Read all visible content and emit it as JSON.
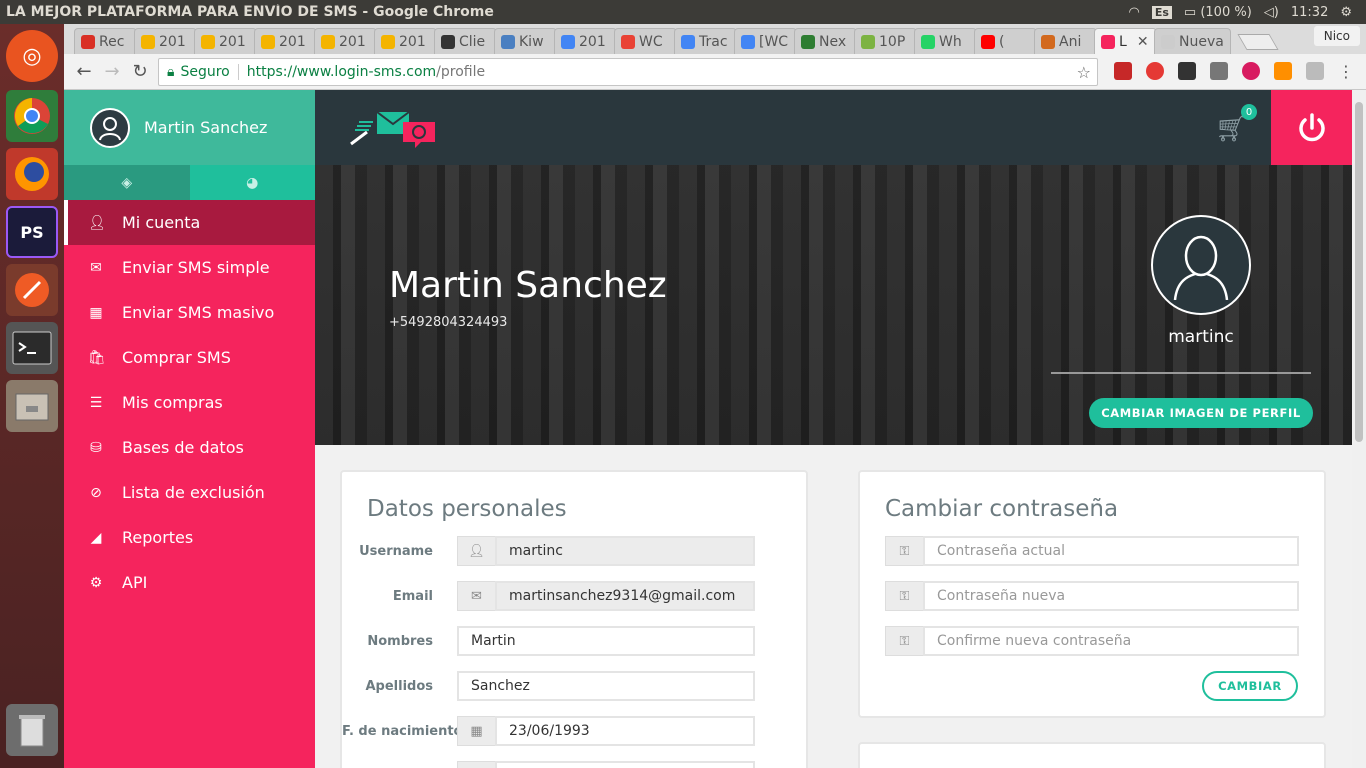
{
  "window": {
    "title": "LA MEJOR PLATAFORMA PARA ENVÍO DE SMS - Google Chrome"
  },
  "tray": {
    "keyboard": "Es",
    "battery": "(100 %)",
    "time": "11:32"
  },
  "browser": {
    "tabs": [
      {
        "label": "Rec",
        "color": "#d93025"
      },
      {
        "label": "201",
        "color": "#f4b400"
      },
      {
        "label": "201",
        "color": "#f4b400"
      },
      {
        "label": "201",
        "color": "#f4b400"
      },
      {
        "label": "201",
        "color": "#f4b400"
      },
      {
        "label": "201",
        "color": "#f4b400"
      },
      {
        "label": "Clie",
        "color": "#333333"
      },
      {
        "label": "Kiw",
        "color": "#4a7fc1"
      },
      {
        "label": "201",
        "color": "#4285f4"
      },
      {
        "label": "WC",
        "color": "#e94235"
      },
      {
        "label": "Trac",
        "color": "#4285f4"
      },
      {
        "label": "[WC",
        "color": "#4285f4"
      },
      {
        "label": "Nex",
        "color": "#2e7d32"
      },
      {
        "label": "10P",
        "color": "#7cb342"
      },
      {
        "label": "Wh",
        "color": "#25d366"
      },
      {
        "label": "(",
        "color": "#ff0000"
      },
      {
        "label": "Ani",
        "color": "#d2691e"
      },
      {
        "label": "L",
        "color": "#f5245d"
      },
      {
        "label": "Nueva",
        "color": "#cccccc"
      }
    ],
    "active_tab_index": 17,
    "profile_name": "Nico",
    "secure_label": "Seguro",
    "url_host": "https://www.login-sms.com",
    "url_path": "/profile"
  },
  "sidebar": {
    "user_name": "Martin Sanchez",
    "items": [
      {
        "label": "Mi cuenta",
        "icon": "user-icon"
      },
      {
        "label": "Enviar SMS simple",
        "icon": "envelope-icon"
      },
      {
        "label": "Enviar SMS masivo",
        "icon": "grid-icon"
      },
      {
        "label": "Comprar SMS",
        "icon": "cart-icon"
      },
      {
        "label": "Mis compras",
        "icon": "list-icon"
      },
      {
        "label": "Bases de datos",
        "icon": "database-icon"
      },
      {
        "label": "Lista de exclusión",
        "icon": "ban-icon"
      },
      {
        "label": "Reportes",
        "icon": "chart-icon"
      },
      {
        "label": "API",
        "icon": "gears-icon"
      }
    ]
  },
  "header": {
    "cart_count": "0"
  },
  "hero": {
    "name": "Martin Sanchez",
    "phone": "+5492804324493",
    "username": "martinc",
    "change_image_label": "CAMBIAR IMAGEN DE PERFIL"
  },
  "personal": {
    "title": "Datos personales",
    "username_label": "Username",
    "username_value": "martinc",
    "email_label": "Email",
    "email_value": "martinsanchez9314@gmail.com",
    "nombres_label": "Nombres",
    "nombres_value": "Martin",
    "apellidos_label": "Apellidos",
    "apellidos_value": "Sanchez",
    "nacimiento_label": "F. de nacimiento",
    "nacimiento_value": "23/06/1993"
  },
  "password": {
    "title": "Cambiar contraseña",
    "current_placeholder": "Contraseña actual",
    "new_placeholder": "Contraseña nueva",
    "confirm_placeholder": "Confirme nueva contraseña",
    "submit_label": "CAMBIAR"
  },
  "colors": {
    "accent": "#f5245d",
    "teal": "#1fbf9c",
    "dark": "#2a373d"
  }
}
